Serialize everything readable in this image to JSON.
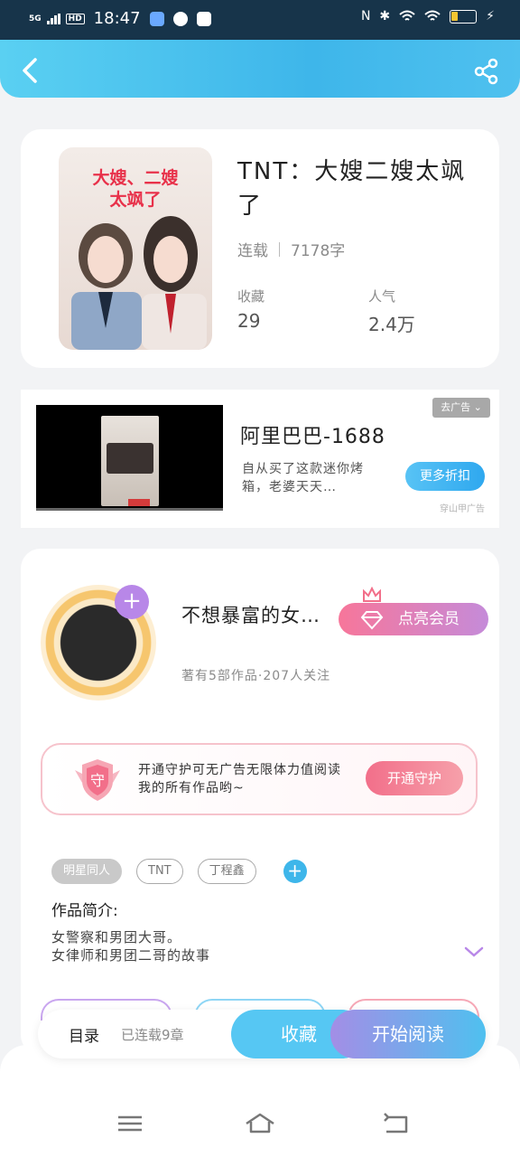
{
  "status_bar": {
    "network": "5G",
    "hd": "HD",
    "time": "18:47",
    "battery": "25",
    "battery_fill": 0.25
  },
  "header": {
    "back_icon": "chevron-left-icon",
    "share_icon": "share-icon"
  },
  "book": {
    "cover_title": "大嫂、二嫂\n太飒了",
    "title": "TNT：大嫂二嫂太飒了",
    "status": "连载",
    "word_count": "7178字",
    "stats": [
      {
        "label": "收藏",
        "value": "29"
      },
      {
        "label": "人气",
        "value": "2.4万"
      }
    ]
  },
  "ad": {
    "tag": "去广告 ⌄",
    "title": "阿里巴巴-1688",
    "description": "自从买了这款迷你烤箱，老婆天天…",
    "button": "更多折扣",
    "source": "穿山甲广告"
  },
  "author": {
    "name": "不想暴富的女…",
    "vip_button": "点亮会员",
    "meta": "著有5部作品·207人关注"
  },
  "guard": {
    "badge": "守",
    "text": "开通守护可无广告无限体力值阅读我的所有作品哟~",
    "button": "开通守护"
  },
  "tags": [
    "明星同人",
    "TNT",
    "丁程鑫"
  ],
  "intro": {
    "label": "作品简介:",
    "lines": [
      "女警察和男团大哥。",
      "女律师和男团二哥的故事"
    ]
  },
  "bottom_bar": {
    "toc": "目录",
    "progress": "已连载9章",
    "favorite": "收藏",
    "read": "开始阅读"
  },
  "colors": {
    "accent_blue": "#3eb6ea",
    "accent_pink": "#f26f8a",
    "accent_purple": "#b887e8"
  }
}
